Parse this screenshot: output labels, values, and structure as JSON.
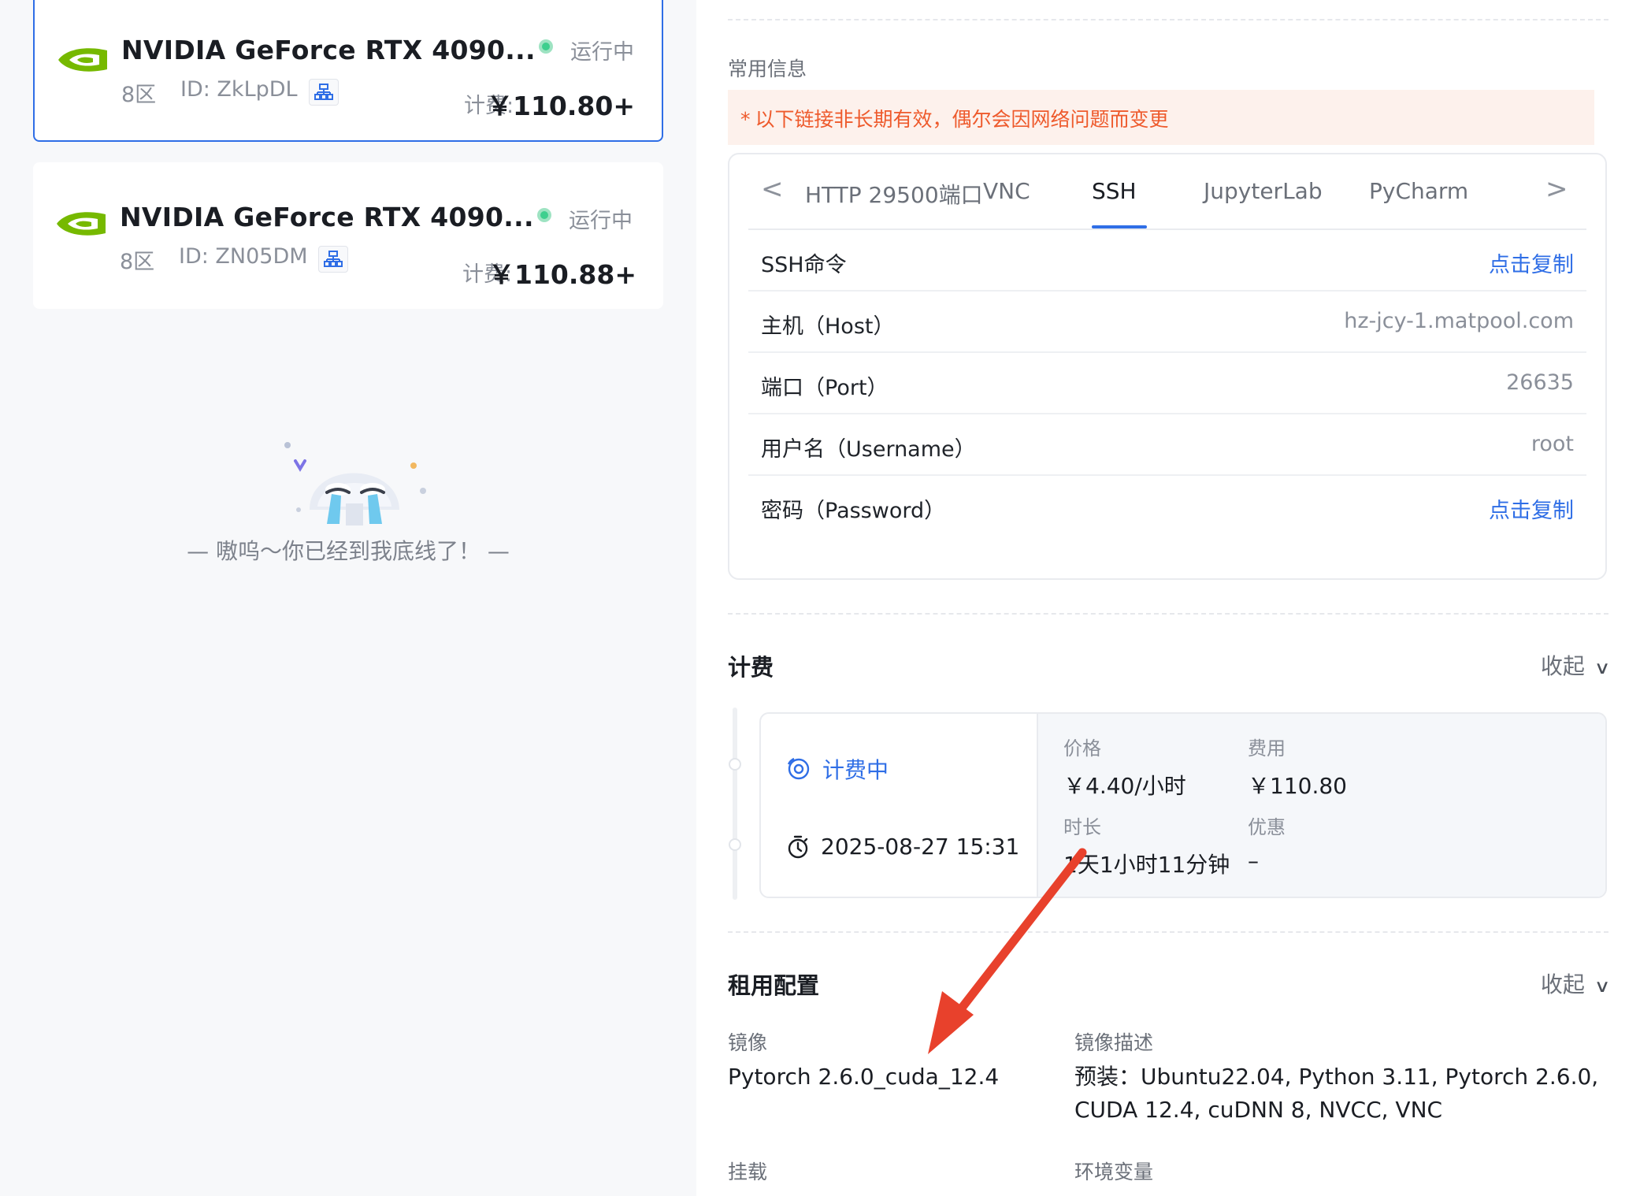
{
  "instances": [
    {
      "name": "NVIDIA GeForce RTX 4090...",
      "zone": "8区",
      "id": "ID: ZkLpDL",
      "status": "运行中",
      "fee_label": "计费:",
      "fee": "￥110.80+",
      "active": true
    },
    {
      "name": "NVIDIA GeForce RTX 4090...",
      "zone": "8区",
      "id": "ID: ZN05DM",
      "status": "运行中",
      "fee_label": "计费:",
      "fee": "￥110.88+",
      "active": false
    }
  ],
  "empty_text": "— 嗷呜～你已经到我底线了！ —",
  "common": {
    "caption": "常用信息",
    "warning": "以下链接非长期有效，偶尔会因网络问题而变更",
    "warning_star": "*"
  },
  "tabs": {
    "items": [
      "HTTP 29500端口",
      "VNC",
      "SSH",
      "JupyterLab",
      "PyCharm"
    ],
    "active": "SSH",
    "prev": "<",
    "next": ">"
  },
  "ssh": {
    "rows": [
      {
        "key": "SSH命令",
        "value": "点击复制",
        "link": true
      },
      {
        "key": "主机（Host）",
        "value": "hz-jcy-1.matpool.com",
        "link": false
      },
      {
        "key": "端口（Port）",
        "value": "26635",
        "link": false
      },
      {
        "key": "用户名（Username）",
        "value": "root",
        "link": false
      },
      {
        "key": "密码（Password）",
        "value": "点击复制",
        "link": true
      }
    ]
  },
  "billing": {
    "title": "计费",
    "collapse": "收起",
    "status": "计费中",
    "start_time": "2025-08-27 15:31",
    "price_label": "价格",
    "price": "￥4.40/小时",
    "cost_label": "费用",
    "cost": "￥110.80",
    "duration_label": "时长",
    "duration": "1天1小时11分钟",
    "discount_label": "优惠",
    "discount": "–"
  },
  "config": {
    "title": "租用配置",
    "collapse": "收起",
    "image_label": "镜像",
    "image": "Pytorch 2.6.0_cuda_12.4",
    "desc_label": "镜像描述",
    "desc_line1": "预装：Ubuntu22.04, Python 3.11, Pytorch 2.6.0,",
    "desc_line2": "CUDA 12.4, cuDNN 8, NVCC, VNC",
    "mount_label": "挂载",
    "env_label": "环境变量"
  },
  "colors": {
    "accent": "#2f6ee6",
    "warning": "#ee5a2c",
    "nvidia_green": "#76b900",
    "annotation_arrow": "#e8412c",
    "running": "#3ecf8e"
  }
}
